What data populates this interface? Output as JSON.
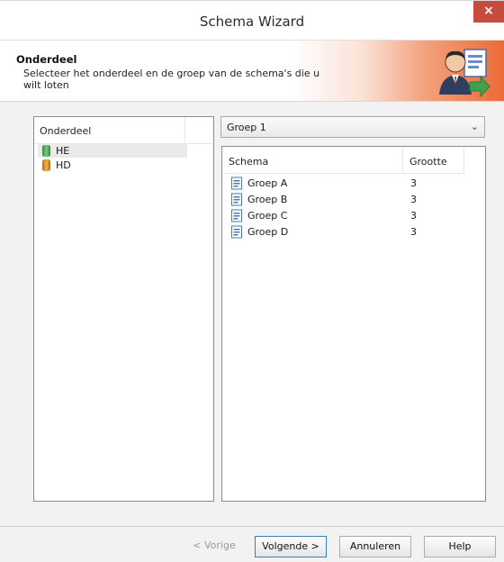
{
  "window": {
    "title": "Schema Wizard",
    "close_label": "×"
  },
  "header": {
    "title": "Onderdeel",
    "description": "Selecteer het onderdeel en de groep van de schema's die u wilt loten"
  },
  "left_panel": {
    "column_header": "Onderdeel",
    "items": [
      {
        "label": "HE",
        "icon": "green-database-icon",
        "color": "#4caf50",
        "selected": true
      },
      {
        "label": "HD",
        "icon": "orange-database-icon",
        "color": "#e89a2c",
        "selected": false
      }
    ]
  },
  "group_select": {
    "value": "Groep 1",
    "arrow": "⌄"
  },
  "schema_table": {
    "columns": [
      "Schema",
      "Grootte"
    ],
    "rows": [
      {
        "name": "Groep A",
        "size": "3"
      },
      {
        "name": "Groep B",
        "size": "3"
      },
      {
        "name": "Groep C",
        "size": "3"
      },
      {
        "name": "Groep D",
        "size": "3"
      }
    ]
  },
  "footer": {
    "back_label": "< Vorige",
    "next_label": "Volgende >",
    "cancel_label": "Annuleren",
    "help_label": "Help"
  }
}
